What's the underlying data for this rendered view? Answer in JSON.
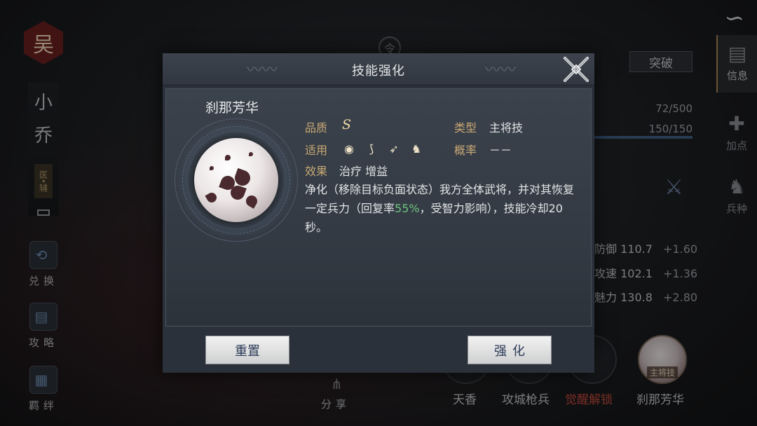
{
  "left": {
    "clan_badge": "吴",
    "hero_name_chars": [
      "小",
      "乔"
    ],
    "role_tag": "医•辅",
    "side_buttons": [
      {
        "label": "兑换",
        "icon": "exchange-icon"
      },
      {
        "label": "攻略",
        "icon": "scroll-icon"
      },
      {
        "label": "羁绊",
        "icon": "bond-icon"
      }
    ]
  },
  "right": {
    "tabs": [
      {
        "label": "信息",
        "icon": "scroll-icon",
        "active": true
      },
      {
        "label": "加点",
        "icon": "add-point-icon",
        "active": false
      },
      {
        "label": "兵种",
        "icon": "troop-icon",
        "active": false
      }
    ],
    "breakthrough_label": "突破",
    "exp_value": "72/500",
    "troop_value": "150/150",
    "stats": [
      {
        "name": "防御",
        "value": "110.7",
        "bonus": "+1.60"
      },
      {
        "name": "攻速",
        "value": "102.1",
        "bonus": "+1.36"
      },
      {
        "name": "魅力",
        "value": "130.8",
        "bonus": "+2.80"
      }
    ]
  },
  "center_token": "令",
  "bottom": {
    "skills": [
      {
        "name": "天香",
        "style": "normal"
      },
      {
        "name": "攻城枪兵",
        "style": "normal"
      },
      {
        "name": "觉醒解锁",
        "style": "red"
      },
      {
        "name": "刹那芳华",
        "style": "normal",
        "tag": "主将技"
      }
    ],
    "share_label": "分享"
  },
  "dialog": {
    "title": "技能强化",
    "skill_name": "刹那芳华",
    "quality_label": "品质",
    "quality_value": "S",
    "type_label": "类型",
    "type_value": "主将技",
    "applicable_label": "适用",
    "applicable_icons": [
      "shield-icon",
      "bow-icon",
      "spear-icon",
      "horse-icon"
    ],
    "chance_label": "概率",
    "chance_value": "－－",
    "effect_label": "效果",
    "effect_value": "治疗 增益",
    "description_before": "净化（移除目标负面状态）我方全体武将，并对其恢复一定兵力（回复率",
    "description_highlight": "55%",
    "description_after": "，受智力影响），技能冷却20秒。",
    "reset_label": "重置",
    "enhance_label": "强化"
  },
  "colors": {
    "accent_gold": "#c8a874",
    "highlight_green": "#6fc37e",
    "button_text": "#2d3b58",
    "warning_red": "#c94b3e"
  }
}
